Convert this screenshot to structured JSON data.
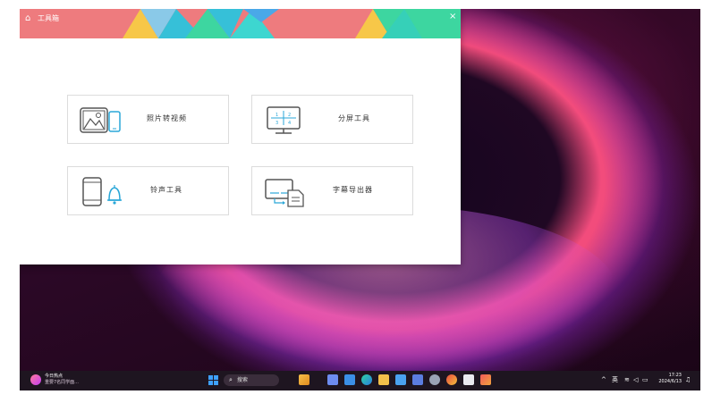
{
  "window": {
    "title": "工具箱",
    "close_glyph": "×",
    "title_icon": "toolbox-icon",
    "banner_colors": [
      "#ee7b7e",
      "#f7c748",
      "#36c0d8",
      "#3dd6a0",
      "#6bd0e8"
    ]
  },
  "tools": [
    {
      "label": "照片转视频",
      "icon": "photo-to-video-icon"
    },
    {
      "label": "分屏工具",
      "icon": "split-screen-icon"
    },
    {
      "label": "铃声工具",
      "icon": "ringtone-icon"
    },
    {
      "label": "字幕导出器",
      "icon": "subtitle-export-icon"
    }
  ],
  "taskbar": {
    "news_title": "今日热点",
    "news_sub": "重要7名同学面...",
    "search_placeholder": "搜索",
    "search_icon": "search-icon",
    "tray_caret": "^",
    "ime": "英",
    "time": "17:23",
    "date": "2024/6/13",
    "notification_icon": "bell-icon",
    "apps": [
      "file-explorer-icon",
      "widgets-icon",
      "edge-browser-icon",
      "edge-icon",
      "folder-icon",
      "store-icon",
      "mail-icon",
      "settings-icon",
      "chrome-icon",
      "app-icon",
      "media-icon"
    ]
  }
}
